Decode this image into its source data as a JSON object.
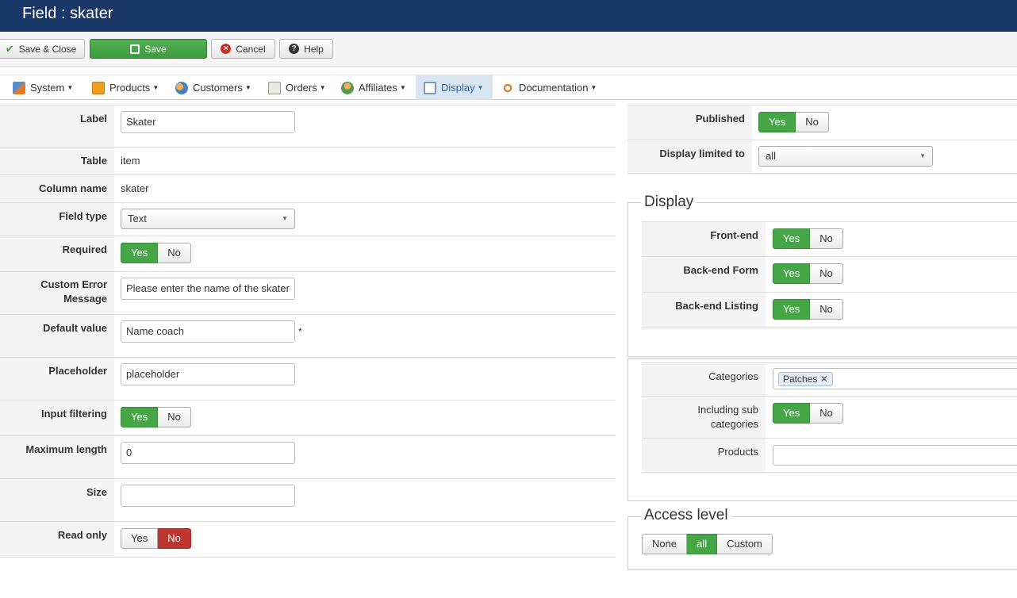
{
  "header": {
    "title": "Field : skater"
  },
  "toolbar": {
    "save_close": "Save & Close",
    "save": "Save",
    "cancel": "Cancel",
    "help": "Help"
  },
  "menu": [
    {
      "label": "System",
      "icon": "tools-icon"
    },
    {
      "label": "Products",
      "icon": "box-icon"
    },
    {
      "label": "Customers",
      "icon": "users-icon"
    },
    {
      "label": "Orders",
      "icon": "orders-icon"
    },
    {
      "label": "Affiliates",
      "icon": "affiliates-icon"
    },
    {
      "label": "Display",
      "icon": "display-icon",
      "active": true
    },
    {
      "label": "Documentation",
      "icon": "docs-icon"
    }
  ],
  "form": {
    "label": {
      "label": "Label",
      "value": "Skater"
    },
    "table": {
      "label": "Table",
      "value": "item"
    },
    "column": {
      "label": "Column name",
      "value": "skater"
    },
    "field_type": {
      "label": "Field type",
      "value": "Text"
    },
    "required": {
      "label": "Required",
      "yes": "Yes",
      "no": "No"
    },
    "custom_error": {
      "label_line1": "Custom Error",
      "label_line2": "Message",
      "value": "Please enter the name of the skater"
    },
    "default_value": {
      "label": "Default value",
      "value": "Name coach",
      "asterisk": "*"
    },
    "placeholder": {
      "label": "Placeholder",
      "value": "placeholder"
    },
    "input_filtering": {
      "label": "Input filtering",
      "yes": "Yes",
      "no": "No"
    },
    "max_length": {
      "label": "Maximum length",
      "value": "0"
    },
    "size": {
      "label": "Size",
      "value": ""
    },
    "read_only": {
      "label": "Read only",
      "yes": "Yes",
      "no": "No"
    }
  },
  "right": {
    "published": {
      "label": "Published",
      "yes": "Yes",
      "no": "No"
    },
    "display_limited": {
      "label": "Display limited to",
      "value": "all"
    },
    "display_legend": "Display",
    "front_end": {
      "label": "Front-end",
      "yes": "Yes",
      "no": "No"
    },
    "backend_form": {
      "label": "Back-end Form",
      "yes": "Yes",
      "no": "No"
    },
    "backend_listing": {
      "label": "Back-end Listing",
      "yes": "Yes",
      "no": "No"
    },
    "categories": {
      "label": "Categories",
      "tag": "Patches"
    },
    "including_sub": {
      "label_line1": "Including sub",
      "label_line2": "categories",
      "yes": "Yes",
      "no": "No"
    },
    "products": {
      "label": "Products",
      "value": ""
    },
    "access_legend": "Access level",
    "access": {
      "none": "None",
      "all": "all",
      "custom": "Custom"
    }
  },
  "colors": {
    "header_bg": "#1a3867",
    "green": "#46a546",
    "red": "#bd362f"
  }
}
